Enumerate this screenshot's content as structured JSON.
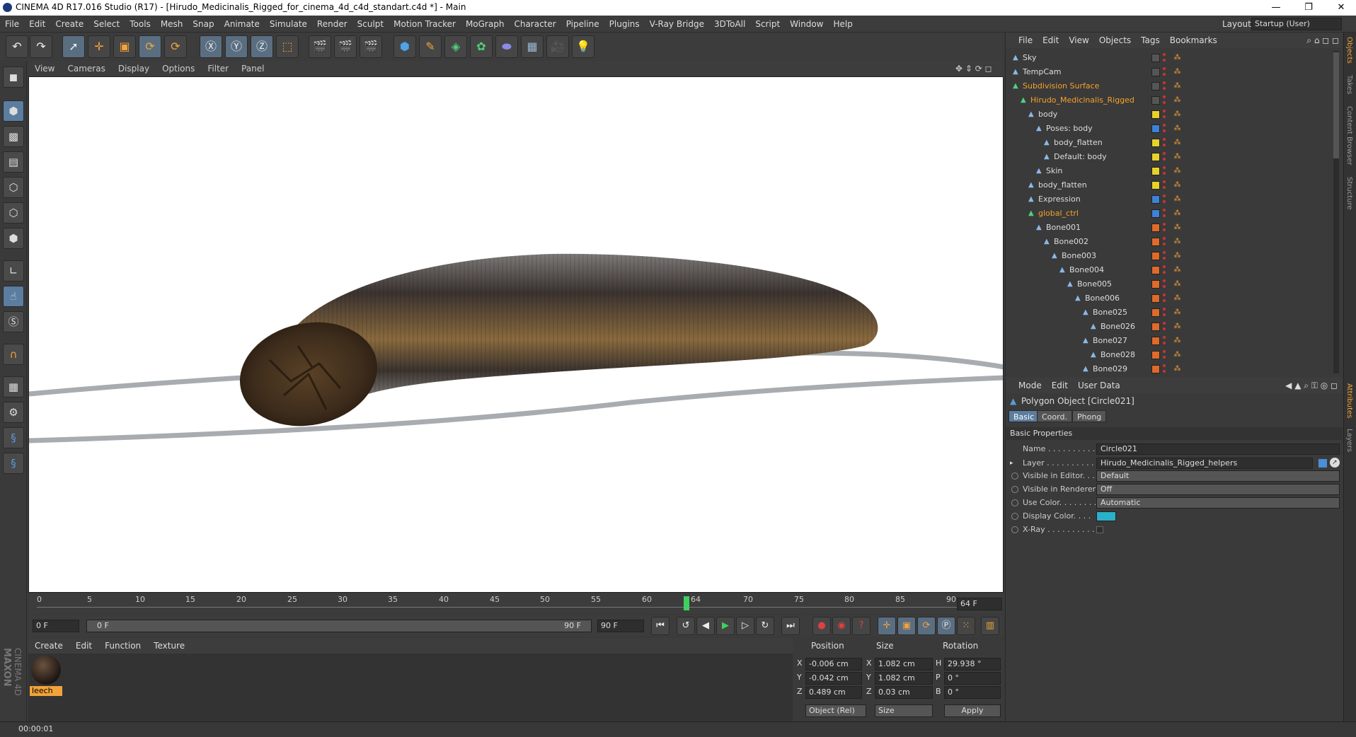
{
  "window": {
    "title": "CINEMA 4D R17.016 Studio (R17) - [Hirudo_Medicinalis_Rigged_for_cinema_4d_c4d_standart.c4d *] - Main",
    "minimize": "—",
    "maximize": "❐",
    "close": "✕"
  },
  "menu": [
    "File",
    "Edit",
    "Create",
    "Select",
    "Tools",
    "Mesh",
    "Snap",
    "Animate",
    "Simulate",
    "Render",
    "Sculpt",
    "Motion Tracker",
    "MoGraph",
    "Character",
    "Pipeline",
    "Plugins",
    "V-Ray Bridge",
    "3DToAll",
    "Script",
    "Window",
    "Help"
  ],
  "layout": {
    "label": "Layout:",
    "value": "Startup (User)"
  },
  "viewport": {
    "menu": [
      "View",
      "Cameras",
      "Display",
      "Options",
      "Filter",
      "Panel"
    ]
  },
  "timeline": {
    "ticks": [
      "0",
      "5",
      "10",
      "15",
      "20",
      "25",
      "30",
      "35",
      "40",
      "45",
      "50",
      "55",
      "60",
      "64",
      "70",
      "75",
      "80",
      "85",
      "90"
    ],
    "current": "64",
    "current_field": "64 F",
    "start": "0 F",
    "range_start": "0 F",
    "range_end": "90 F",
    "end": "90 F"
  },
  "material": {
    "menu": [
      "Create",
      "Edit",
      "Function",
      "Texture"
    ],
    "name": "leech"
  },
  "coords": {
    "headers": [
      "Position",
      "Size",
      "Rotation"
    ],
    "rows": [
      {
        "axis": "X",
        "pos": "-0.006 cm",
        "saxis": "X",
        "size": "1.082 cm",
        "raxis": "H",
        "rot": "29.938 °"
      },
      {
        "axis": "Y",
        "pos": "-0.042 cm",
        "saxis": "Y",
        "size": "1.082 cm",
        "raxis": "P",
        "rot": "0 °"
      },
      {
        "axis": "Z",
        "pos": "0.489 cm",
        "saxis": "Z",
        "size": "0.03 cm",
        "raxis": "B",
        "rot": "0 °"
      }
    ],
    "mode": "Object (Rel)",
    "size_mode": "Size",
    "apply": "Apply"
  },
  "status": "00:00:01",
  "objects": {
    "menu": [
      "File",
      "Edit",
      "View",
      "Objects",
      "Tags",
      "Bookmarks"
    ],
    "items": [
      {
        "name": "Sky",
        "indent": 0,
        "color": "none",
        "orange": false
      },
      {
        "name": "TempCam",
        "indent": 0,
        "color": "none",
        "orange": false
      },
      {
        "name": "Subdivision Surface",
        "indent": 0,
        "color": "none",
        "orange": true
      },
      {
        "name": "Hirudo_Medicinalis_Rigged",
        "indent": 1,
        "color": "none",
        "orange": true
      },
      {
        "name": "body",
        "indent": 2,
        "color": "#e6d22a",
        "orange": false
      },
      {
        "name": "Poses: body",
        "indent": 3,
        "color": "#3d82d6",
        "orange": false
      },
      {
        "name": "body_flatten",
        "indent": 4,
        "color": "#e6d22a",
        "orange": false
      },
      {
        "name": "Default: body",
        "indent": 4,
        "color": "#e6d22a",
        "orange": false
      },
      {
        "name": "Skin",
        "indent": 3,
        "color": "#e6d22a",
        "orange": false
      },
      {
        "name": "body_flatten",
        "indent": 2,
        "color": "#e6d22a",
        "orange": false
      },
      {
        "name": "Expression",
        "indent": 2,
        "color": "#3d82d6",
        "orange": false
      },
      {
        "name": "global_ctrl",
        "indent": 2,
        "color": "#3d82d6",
        "orange": true
      },
      {
        "name": "Bone001",
        "indent": 3,
        "color": "#e06a2a",
        "orange": false
      },
      {
        "name": "Bone002",
        "indent": 4,
        "color": "#e06a2a",
        "orange": false
      },
      {
        "name": "Bone003",
        "indent": 5,
        "color": "#e06a2a",
        "orange": false
      },
      {
        "name": "Bone004",
        "indent": 6,
        "color": "#e06a2a",
        "orange": false
      },
      {
        "name": "Bone005",
        "indent": 7,
        "color": "#e06a2a",
        "orange": false
      },
      {
        "name": "Bone006",
        "indent": 8,
        "color": "#e06a2a",
        "orange": false
      },
      {
        "name": "Bone025",
        "indent": 9,
        "color": "#e06a2a",
        "orange": false
      },
      {
        "name": "Bone026",
        "indent": 10,
        "color": "#e06a2a",
        "orange": false
      },
      {
        "name": "Bone027",
        "indent": 9,
        "color": "#e06a2a",
        "orange": false
      },
      {
        "name": "Bone028",
        "indent": 10,
        "color": "#e06a2a",
        "orange": false
      },
      {
        "name": "Bone029",
        "indent": 9,
        "color": "#e06a2a",
        "orange": false
      }
    ]
  },
  "attributes": {
    "menu": [
      "Mode",
      "Edit",
      "User Data"
    ],
    "object": "Polygon Object [Circle021]",
    "tabs": [
      "Basic",
      "Coord.",
      "Phong"
    ],
    "section": "Basic Properties",
    "props": [
      {
        "label": "Name . . . . . . . . . . .",
        "value": "Circle021",
        "radio": false
      },
      {
        "label": "Layer . . . . . . . . . . .",
        "value": "Hirudo_Medicinalis_Rigged_helpers",
        "radio": false
      },
      {
        "label": "Visible in Editor. . .",
        "value": "Default",
        "radio": true
      },
      {
        "label": "Visible in Renderer",
        "value": "Off",
        "radio": true
      },
      {
        "label": "Use Color. . . . . . . .",
        "value": "Automatic",
        "radio": true
      },
      {
        "label": "Display Color. . . .",
        "value": "",
        "radio": true
      },
      {
        "label": "X-Ray . . . . . . . . . .",
        "value": "",
        "radio": true
      }
    ],
    "display_color": "#2ab0c8"
  },
  "side_tabs": [
    "Objects",
    "Takes",
    "Content Browser",
    "Structure",
    "Attributes",
    "Layers"
  ],
  "brand": [
    "MAXON",
    "CINEMA 4D"
  ]
}
